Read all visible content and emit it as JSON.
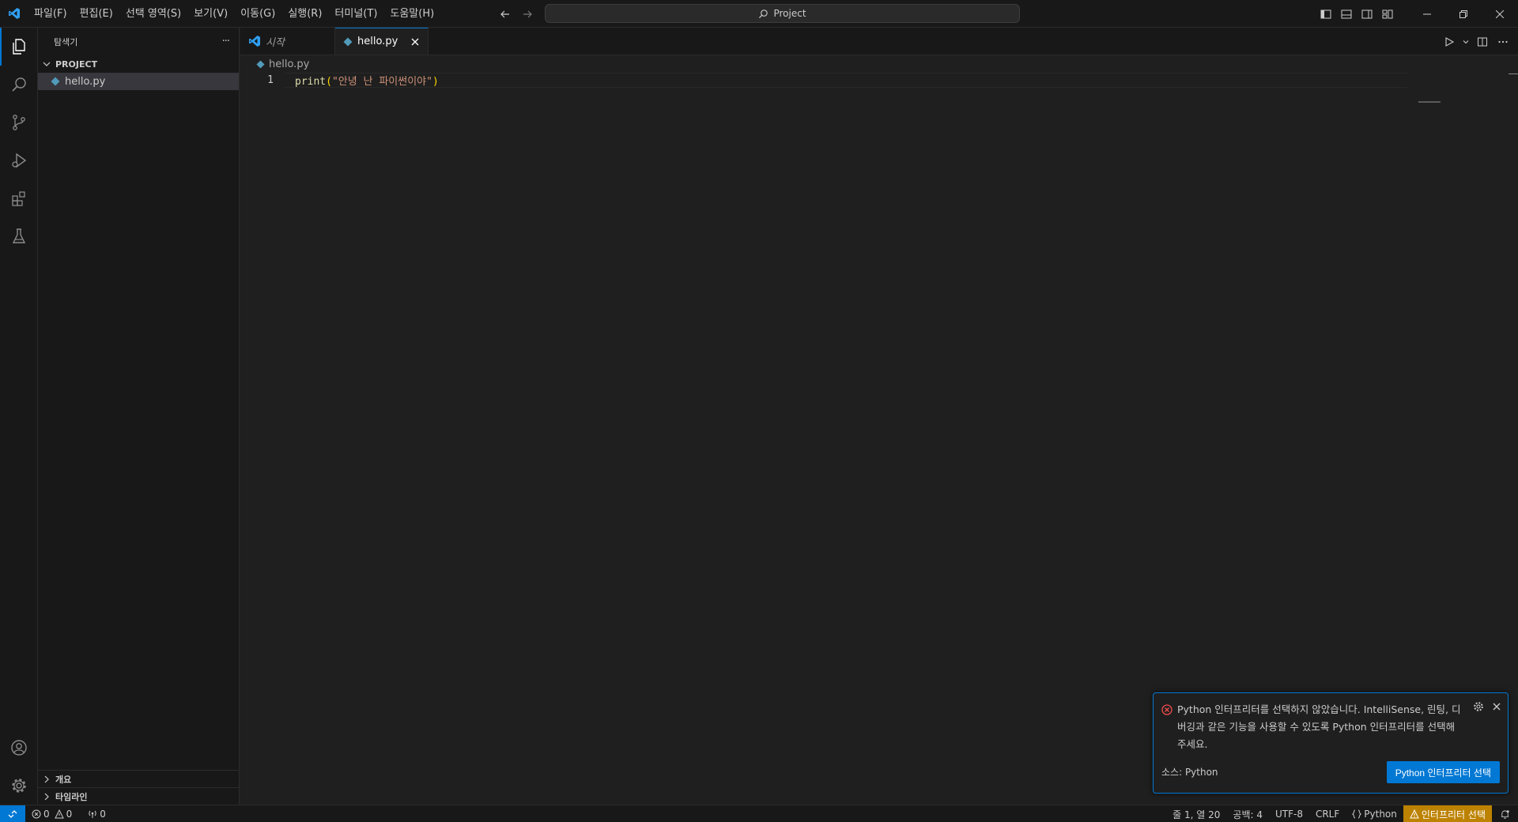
{
  "titlebar": {
    "menu": [
      "파일(F)",
      "편집(E)",
      "선택 영역(S)",
      "보기(V)",
      "이동(G)",
      "실행(R)",
      "터미널(T)",
      "도움말(H)"
    ],
    "search_text": "Project"
  },
  "sidebar": {
    "title": "탐색기",
    "more": "···",
    "folder": "PROJECT",
    "files": [
      "hello.py"
    ],
    "outline": "개요",
    "timeline": "타임라인"
  },
  "tabs": [
    {
      "label": "시작",
      "active": false
    },
    {
      "label": "hello.py",
      "active": true
    }
  ],
  "editor": {
    "breadcrumb": "hello.py",
    "lines": [
      {
        "number": "1",
        "fn": "print",
        "open": "(",
        "string": "\"안녕 난 파이썬이야\"",
        "close": ")"
      }
    ]
  },
  "notification": {
    "message": "Python 인터프리터를 선택하지 않았습니다. IntelliSense, 린팅, 디버깅과 같은 기능을 사용할 수 있도록 Python 인터프리터를 선택해 주세요.",
    "source": "소스: Python",
    "button": "Python 인터프리터 선택"
  },
  "statusbar": {
    "errors": "0",
    "warnings": "0",
    "ports": "0",
    "position": "줄 1, 열 20",
    "spaces": "공백: 4",
    "encoding": "UTF-8",
    "eol": "CRLF",
    "language": "Python",
    "interpreter_warning": "인터프리터 선택"
  },
  "colors": {
    "accent": "#0078d4",
    "warning_bg": "#bd8200",
    "python_icon": "#519aba"
  }
}
